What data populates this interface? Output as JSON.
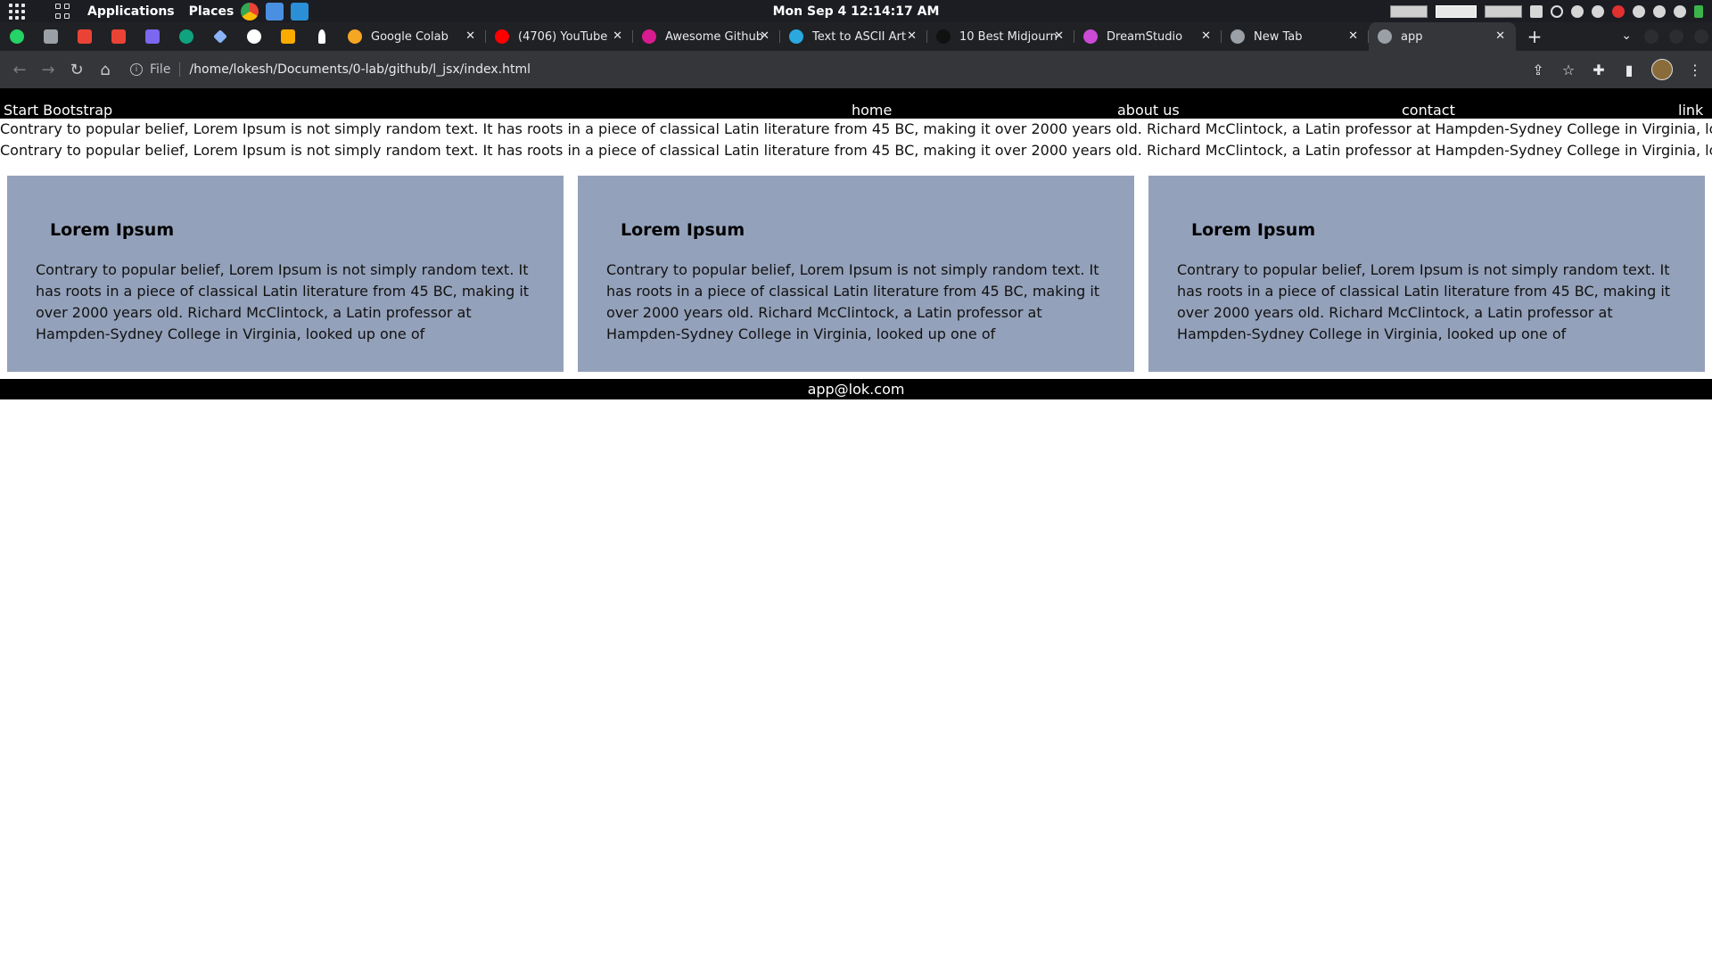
{
  "system_panel": {
    "menus": [
      "Applications",
      "Places"
    ],
    "clock": "Mon Sep 4  12:14:17 AM"
  },
  "browser": {
    "tabs": [
      {
        "title": "Google Colab",
        "favicon_color": "#f5a623"
      },
      {
        "title": "(4706) YouTube",
        "favicon_color": "#ff0000"
      },
      {
        "title": "Awesome Github",
        "favicon_color": "#d81b8e"
      },
      {
        "title": "Text to ASCII Art",
        "favicon_color": "#29a9e0"
      },
      {
        "title": "10 Best Midjourn",
        "favicon_color": "#111111"
      },
      {
        "title": "DreamStudio",
        "favicon_color": "#c94bd6"
      },
      {
        "title": "New Tab",
        "favicon_color": "#9aa0a6"
      },
      {
        "title": "app",
        "favicon_color": "#9aa0a6",
        "active": true
      }
    ],
    "pinned_icon_colors": [
      "#25d366",
      "#9aa0a6",
      "#ea4335",
      "#ea4335",
      "#7b68ee",
      "#10a37f",
      "#8ab4f8",
      "#ffffff",
      "#f9ab00",
      "#ffffff"
    ],
    "address": {
      "scheme": "File",
      "url": "/home/lokesh/Documents/0-lab/github/l_jsx/index.html"
    }
  },
  "page": {
    "navbar": {
      "brand": "Start Bootstrap",
      "links": [
        "home",
        "about us",
        "contact",
        "link"
      ]
    },
    "intro_lines": [
      "Contrary to popular belief, Lorem Ipsum is not simply random text. It has roots in a piece of classical Latin literature from 45 BC, making it over 2000 years old. Richard McClintock, a Latin professor at Hampden-Sydney College in Virginia, looked up one of",
      "Contrary to popular belief, Lorem Ipsum is not simply random text. It has roots in a piece of classical Latin literature from 45 BC, making it over 2000 years old. Richard McClintock, a Latin professor at Hampden-Sydney College in Virginia, looked up one of"
    ],
    "cards": [
      {
        "title": "Lorem Ipsum",
        "body": "Contrary to popular belief, Lorem Ipsum is not simply random text. It has roots in a piece of classical Latin literature from 45 BC, making it over 2000 years old. Richard McClintock, a Latin professor at Hampden-Sydney College in Virginia, looked up one of"
      },
      {
        "title": "Lorem Ipsum",
        "body": "Contrary to popular belief, Lorem Ipsum is not simply random text. It has roots in a piece of classical Latin literature from 45 BC, making it over 2000 years old. Richard McClintock, a Latin professor at Hampden-Sydney College in Virginia, looked up one of"
      },
      {
        "title": "Lorem Ipsum",
        "body": "Contrary to popular belief, Lorem Ipsum is not simply random text. It has roots in a piece of classical Latin literature from 45 BC, making it over 2000 years old. Richard McClintock, a Latin professor at Hampden-Sydney College in Virginia, looked up one of"
      }
    ],
    "footer": "app@lok.com",
    "colors": {
      "card_bg": "#94a1ba",
      "navbar_bg": "#000000"
    }
  }
}
